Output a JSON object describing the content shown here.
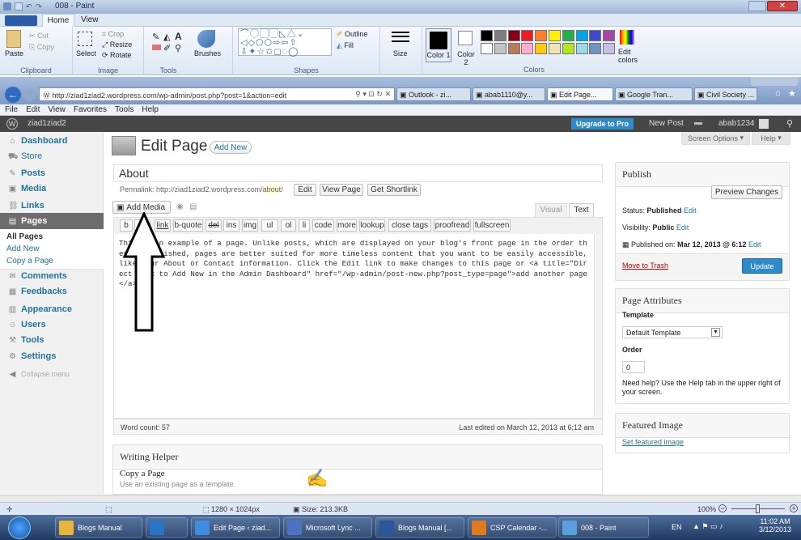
{
  "paint": {
    "title": "008 - Paint",
    "tabs": [
      "Home",
      "View"
    ],
    "clipboard": {
      "paste": "Paste",
      "cut": "Cut",
      "copy": "Copy",
      "label": "Clipboard"
    },
    "image": {
      "select": "Select",
      "crop": "Crop",
      "resize": "Resize",
      "rotate": "Rotate",
      "label": "Image"
    },
    "tools": {
      "label": "Tools",
      "brushes": "Brushes"
    },
    "shapes": {
      "outline": "Outline",
      "fill": "Fill",
      "label": "Shapes"
    },
    "size_label": "Size",
    "color1": "Color 1",
    "color2": "Color 2",
    "colors_label": "Colors",
    "edit_colors": "Edit colors",
    "palette": [
      "#000000",
      "#7f7f7f",
      "#880015",
      "#ed1c24",
      "#ff7f27",
      "#fff200",
      "#22b14c",
      "#00a2e8",
      "#3f48cc",
      "#a349a4",
      "#ffffff",
      "#c3c3c3",
      "#b97a57",
      "#ffaec9",
      "#ffc90e",
      "#efe4b0",
      "#b5e61d",
      "#99d9ea",
      "#7092be",
      "#c8bfe7"
    ]
  },
  "ie": {
    "url": "http://ziad1ziad2.wordpress.com/wp-admin/post.php?post=1&action=edit",
    "tabs": [
      "Outlook - zi...",
      "abab1110@y...",
      "Edit Page...",
      "Google Tran...",
      "Civil Society ..."
    ],
    "menu": [
      "File",
      "Edit",
      "View",
      "Favorites",
      "Tools",
      "Help"
    ]
  },
  "wp": {
    "site": "ziad1ziad2",
    "upgrade": "Upgrade to Pro",
    "new_post": "New Post",
    "user": "abab1234",
    "sidebar": [
      "Dashboard",
      "Store",
      "Posts",
      "Media",
      "Links",
      "Pages",
      "Comments",
      "Feedbacks",
      "Appearance",
      "Users",
      "Tools",
      "Settings",
      "Collapse menu"
    ],
    "pages_sub": [
      "All Pages",
      "Add New",
      "Copy a Page"
    ],
    "screen_options": "Screen Options",
    "help": "Help",
    "heading": "Edit Page",
    "add_new": "Add New",
    "post_title": "About",
    "permalink_label": "Permalink: http://ziad1ziad2.wordpress.com/",
    "permalink_slug": "about",
    "permalink_end": "/",
    "edit": "Edit",
    "view_page": "View Page",
    "get_shortlink": "Get Shortlink",
    "add_media": "Add Media",
    "visual": "Visual",
    "text": "Text",
    "quicktags": [
      "b",
      "i",
      "link",
      "b-quote",
      "del",
      "ins",
      "img",
      "ul",
      "ol",
      "li",
      "code",
      "more",
      "lookup",
      "close tags",
      "proofread",
      "fullscreen"
    ],
    "content": "This is an example of a page. Unlike posts, which are displayed on your blog’s front page in the order they’re published, pages are better suited for more timeless content that you want to be easily accessible, like your About or Contact information. Click the Edit link to make changes to this page or <a title=\"Direct link to Add New in the Admin Dashboard\" href=\"/wp-admin/post-new.php?post_type=page\">add another page</a>.",
    "word_count": "Word count: 57",
    "last_edited": "Last edited on March 12, 2013 at 6:12 am",
    "writing_helper": "Writing Helper",
    "copy_page": "Copy a Page",
    "copy_page_desc": "Use an existing page as a template.",
    "publish": "Publish",
    "preview": "Preview Changes",
    "status_label": "Status:",
    "status": "Published",
    "visibility_label": "Visibility:",
    "visibility": "Public",
    "published_on_label": "Published on:",
    "published_on": "Mar 12, 2013 @ 6:12",
    "trash": "Move to Trash",
    "update": "Update",
    "page_attributes": "Page Attributes",
    "template_label": "Template",
    "template_value": "Default Template",
    "order_label": "Order",
    "order_value": "0",
    "help_text": "Need help? Use the Help tab in the upper right of your screen.",
    "featured_image": "Featured Image",
    "set_featured": "Set featured image"
  },
  "status": {
    "dims": "1280 × 1024px",
    "size": "Size: 213.3KB",
    "zoom": "100%"
  },
  "taskbar": {
    "items": [
      "Blogs Manual",
      "",
      "Edit Page ‹ ziad...",
      "Microsoft Lync ...",
      "Blogs Manual [...",
      "CSP Calendar -...",
      "008 - Paint"
    ],
    "lang": "EN",
    "time": "11:02 AM",
    "date": "3/12/2013"
  },
  "colors": {
    "wp_blue": "#21759b",
    "update_blue": "#2e8ac9",
    "admin_bar": "#464646",
    "pages_active": "#6d6d6d"
  }
}
